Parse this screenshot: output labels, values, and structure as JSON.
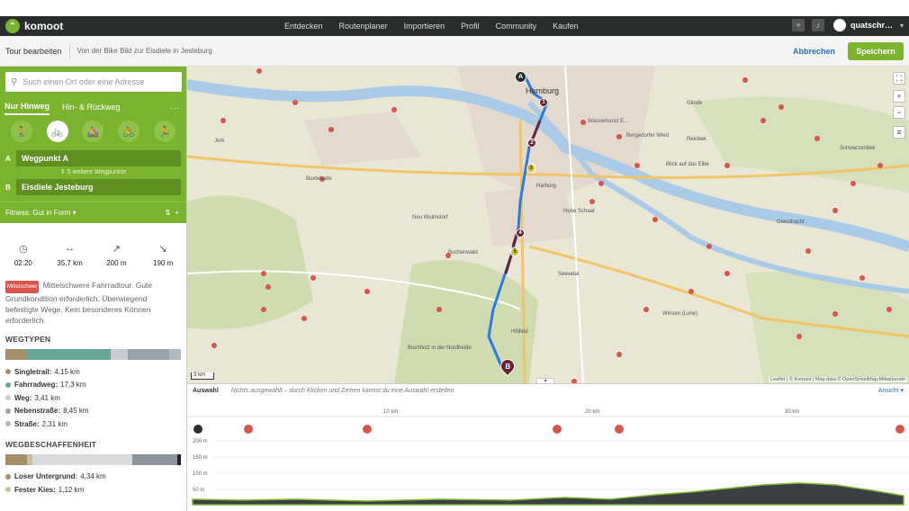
{
  "app": {
    "name": "komoot",
    "logo_glyph": "⌃",
    "accent": "#7ab32e"
  },
  "nav": {
    "links": [
      "Entdecken",
      "Routenplaner",
      "Importieren",
      "Profil",
      "Community",
      "Kaufen"
    ],
    "user": "quatschr…"
  },
  "subheader": {
    "title": "Tour bearbeiten",
    "description": "Von der Bike Bild zur Eisdiele in Jesteburg",
    "cancel": "Abbrechen",
    "save": "Speichern"
  },
  "sidebar": {
    "search_placeholder": "Such einen Ort oder eine Adresse",
    "tabs": [
      "Nur Hinweg",
      "Hin- & Rückweg"
    ],
    "waypoint_a_letter": "A",
    "waypoint_a": "Wegpunkt A",
    "waypoint_more": "⇕ 5 weitere Wegpunkte",
    "waypoint_b_letter": "B",
    "waypoint_b": "Eisdiele Jesteburg",
    "fitness": "Fitness: Gut in Form ▾",
    "stats": {
      "duration": "02:20",
      "distance": "35,7 km",
      "ascent": "200 m",
      "descent": "190 m"
    },
    "difficulty_badge": "Mittelschwer",
    "description": "Mittelschwere Fahrradtour. Gute Grundkondition erforderlich. Überwiegend befestigte Wege. Kein besonderes Können erforderlich.",
    "wegtypen_title": "WEGTYPEN",
    "wegtypen": [
      {
        "label": "Singletrail:",
        "value": "4,15 km",
        "color": "#a58e6a",
        "share": 4.15
      },
      {
        "label": "Fahrradweg:",
        "value": "17,3 km",
        "color": "#6aa698",
        "share": 17.3
      },
      {
        "label": "Weg:",
        "value": "3,41 km",
        "color": "#c8ccd0",
        "share": 3.41
      },
      {
        "label": "Nebenstraße:",
        "value": "8,45 km",
        "color": "#9aa4ac",
        "share": 8.45
      },
      {
        "label": "Straße:",
        "value": "2,31 km",
        "color": "#b0b8c0",
        "share": 2.31
      }
    ],
    "wegbeschaffenheit_title": "WEGBESCHAFFENHEIT",
    "wegbeschaffenheit": [
      {
        "label": "Loser Untergrund:",
        "value": "4,34 km",
        "color": "#a58e6a",
        "share": 4.34
      },
      {
        "label": "Fester Kies:",
        "value": "1,12 km",
        "color": "#c8bfa8",
        "share": 1.12
      }
    ],
    "wegbeschaffenheit_bar": [
      {
        "color": "#a58e6a",
        "share": 4.34
      },
      {
        "color": "#c8bfa8",
        "share": 1.12
      },
      {
        "color": "#d8dadc",
        "share": 20
      },
      {
        "color": "#8c959e",
        "share": 9
      },
      {
        "color": "#222222",
        "share": 0.8
      }
    ]
  },
  "map": {
    "places": [
      {
        "name": "Hamburg",
        "cls": "city"
      },
      {
        "name": "Glinde"
      },
      {
        "name": "Reinbek"
      },
      {
        "name": "Schwarzenbek"
      },
      {
        "name": "Wasserkunst E..."
      },
      {
        "name": "Bergedorfer Wied"
      },
      {
        "name": "Blick auf das Elbe"
      },
      {
        "name": "Buxtehude"
      },
      {
        "name": "Neu Wulmstorf"
      },
      {
        "name": "Seevetal"
      },
      {
        "name": "Winsen (Luhe)"
      },
      {
        "name": "Buchholz in der Nordheide"
      },
      {
        "name": "Hittfeld"
      },
      {
        "name": "Jork"
      },
      {
        "name": "Geesthacht"
      },
      {
        "name": "Buchenwald"
      },
      {
        "name": "Hohe Schaar"
      },
      {
        "name": "Harburg"
      }
    ],
    "scale": "3 km",
    "attribution": "Leaflet | © Komoot | Map data © OpenStreetMap-Mitwirkende",
    "marker_a": "A",
    "marker_b": "B",
    "waypoints": [
      "1",
      "2",
      "3",
      "4",
      "5"
    ],
    "route_color": "#2c7be5",
    "route_color_secondary": "#6b2332"
  },
  "elevation": {
    "selection_label": "Auswahl",
    "hint": "Nichts ausgewählt – durch Klicken und Ziehen kannst du eine Auswahl erstellen",
    "view_toggle": "Ansicht ▾",
    "x_ticks": [
      "10 km",
      "20 km",
      "30 km"
    ],
    "y_ticks": [
      "200 m",
      "150 m",
      "100 m",
      "50 m"
    ]
  }
}
